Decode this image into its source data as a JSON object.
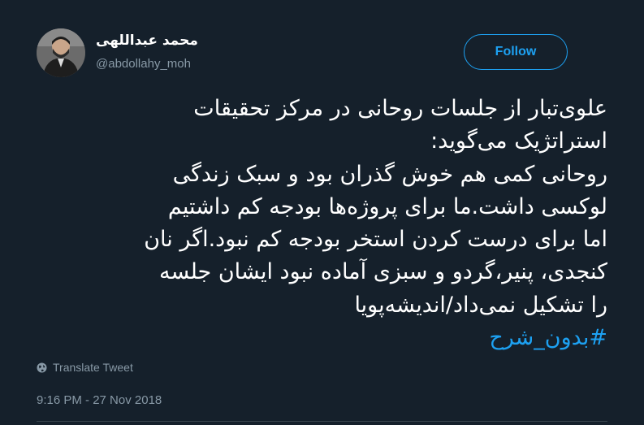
{
  "user": {
    "display_name": "محمد عبداللهی",
    "handle": "@abdollahy_moh"
  },
  "follow_button": {
    "label": "Follow"
  },
  "tweet": {
    "lines": [
      "علوی‌تبار از جلسات روحانی در مرکز تحقیقات",
      "استراتژیک می‌گوید:",
      "روحانی کمی هم خوش گذران بود و سبک زندگی",
      "لوکسی داشت.ما برای پروژه‌ها بودجه کم داشتیم",
      "اما برای درست کردن استخر بودجه کم نبود.اگر نان",
      "کنجدی، پنیر،گردو و سبزی آماده نبود ایشان جلسه",
      "را تشکیل نمی‌داد/اندیشه‌پویا"
    ],
    "hashtag": "#بدون_شرح"
  },
  "translate": {
    "label": "Translate Tweet",
    "icon": "globe-icon"
  },
  "timestamp": "9:16 PM - 27 Nov 2018",
  "colors": {
    "background": "#15202b",
    "accent": "#1da1f2",
    "secondary_text": "#8899a6",
    "divider": "#38444d"
  }
}
